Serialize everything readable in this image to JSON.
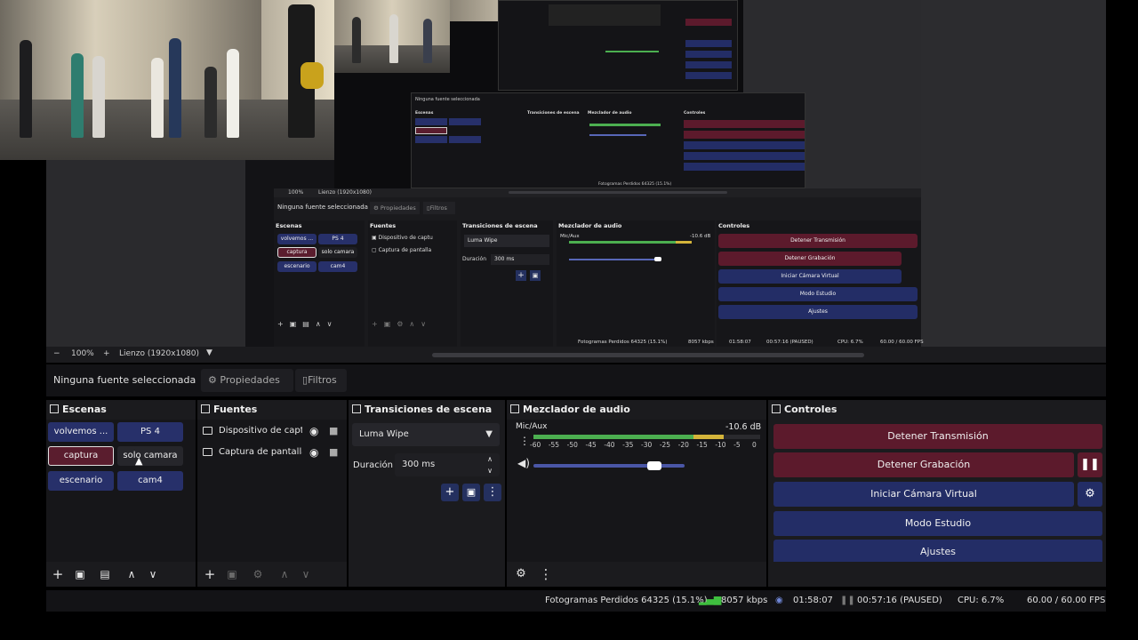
{
  "preview": {
    "zoom": "100%",
    "canvas": "Lienzo (1920x1080)",
    "minus": "−",
    "plus": "+",
    "dropdown_icon": "caret-down-icon"
  },
  "nested": {
    "source_none": "Ninguna fuente seleccionada",
    "properties": "Propiedades",
    "filters": "Filtros",
    "scenes_title": "Escenas",
    "sources_title": "Fuentes",
    "transitions_title": "Transiciones de escena",
    "mixer_title": "Mezclador de audio",
    "controls_title": "Controles",
    "scenes": [
      "volvemos ...",
      "PS 4",
      "captura",
      "solo camara",
      "escenario",
      "cam4"
    ],
    "sources": [
      "Dispositivo de captu",
      "Captura de pantalla"
    ],
    "transition": "Luma Wipe",
    "duration_label": "Duración",
    "duration": "300 ms",
    "mixer_channel": "Mic/Aux",
    "mixer_db": "-10.6 dB",
    "controls": [
      "Detener Transmisión",
      "Detener Grabación",
      "Iniciar Cámara Virtual",
      "Modo Estudio",
      "Ajustes"
    ],
    "zoom": "100%",
    "canvas": "Lienzo (1920x1080)",
    "status": {
      "dropped": "Fotogramas Perdidos 64325 (15.1%)",
      "kbps": "8057 kbps",
      "stream_time": "01:58:07",
      "rec_time": "00:57:16 (PAUSED)",
      "cpu": "CPU: 6.7%",
      "fps": "60.00 / 60.00 FPS"
    }
  },
  "source_bar": {
    "none_selected": "Ninguna fuente seleccionada",
    "properties": "Propiedades",
    "filters": "Filtros"
  },
  "scenes": {
    "title": "Escenas",
    "items": [
      {
        "label": "volvemos ..."
      },
      {
        "label": "PS 4"
      },
      {
        "label": "captura"
      },
      {
        "label": "solo camara"
      },
      {
        "label": "escenario"
      },
      {
        "label": "cam4"
      }
    ]
  },
  "sources": {
    "title": "Fuentes",
    "items": [
      {
        "label": "Dispositivo de captu"
      },
      {
        "label": "Captura de pantalla"
      }
    ]
  },
  "transitions": {
    "title": "Transiciones de escena",
    "selected": "Luma Wipe",
    "duration_label": "Duración",
    "duration_value": "300 ms"
  },
  "mixer": {
    "title": "Mezclador de audio",
    "channel": "Mic/Aux",
    "db": "-10.6 dB",
    "scale": [
      "-60",
      "-55",
      "-50",
      "-45",
      "-40",
      "-35",
      "-30",
      "-25",
      "-20",
      "-15",
      "-10",
      "-5",
      "0"
    ],
    "volume_level": 0.8
  },
  "controls": {
    "title": "Controles",
    "stop_stream": "Detener Transmisión",
    "stop_record": "Detener Grabación",
    "virtual_cam": "Iniciar Cámara Virtual",
    "studio_mode": "Modo Estudio",
    "settings": "Ajustes"
  },
  "status": {
    "dropped_frames": "Fotogramas Perdidos 64325 (15.1%)",
    "bitrate": "8057 kbps",
    "stream_time": "01:58:07",
    "record_time": "00:57:16 (PAUSED)",
    "cpu": "CPU: 6.7%",
    "fps": "60.00 / 60.00 FPS"
  },
  "colors": {
    "accent_blue": "#232d66",
    "accent_red": "#5c1a2c",
    "meter_green": "#4caf50",
    "meter_yellow": "#d4b43a",
    "signal_green": "#3fbf3f"
  }
}
